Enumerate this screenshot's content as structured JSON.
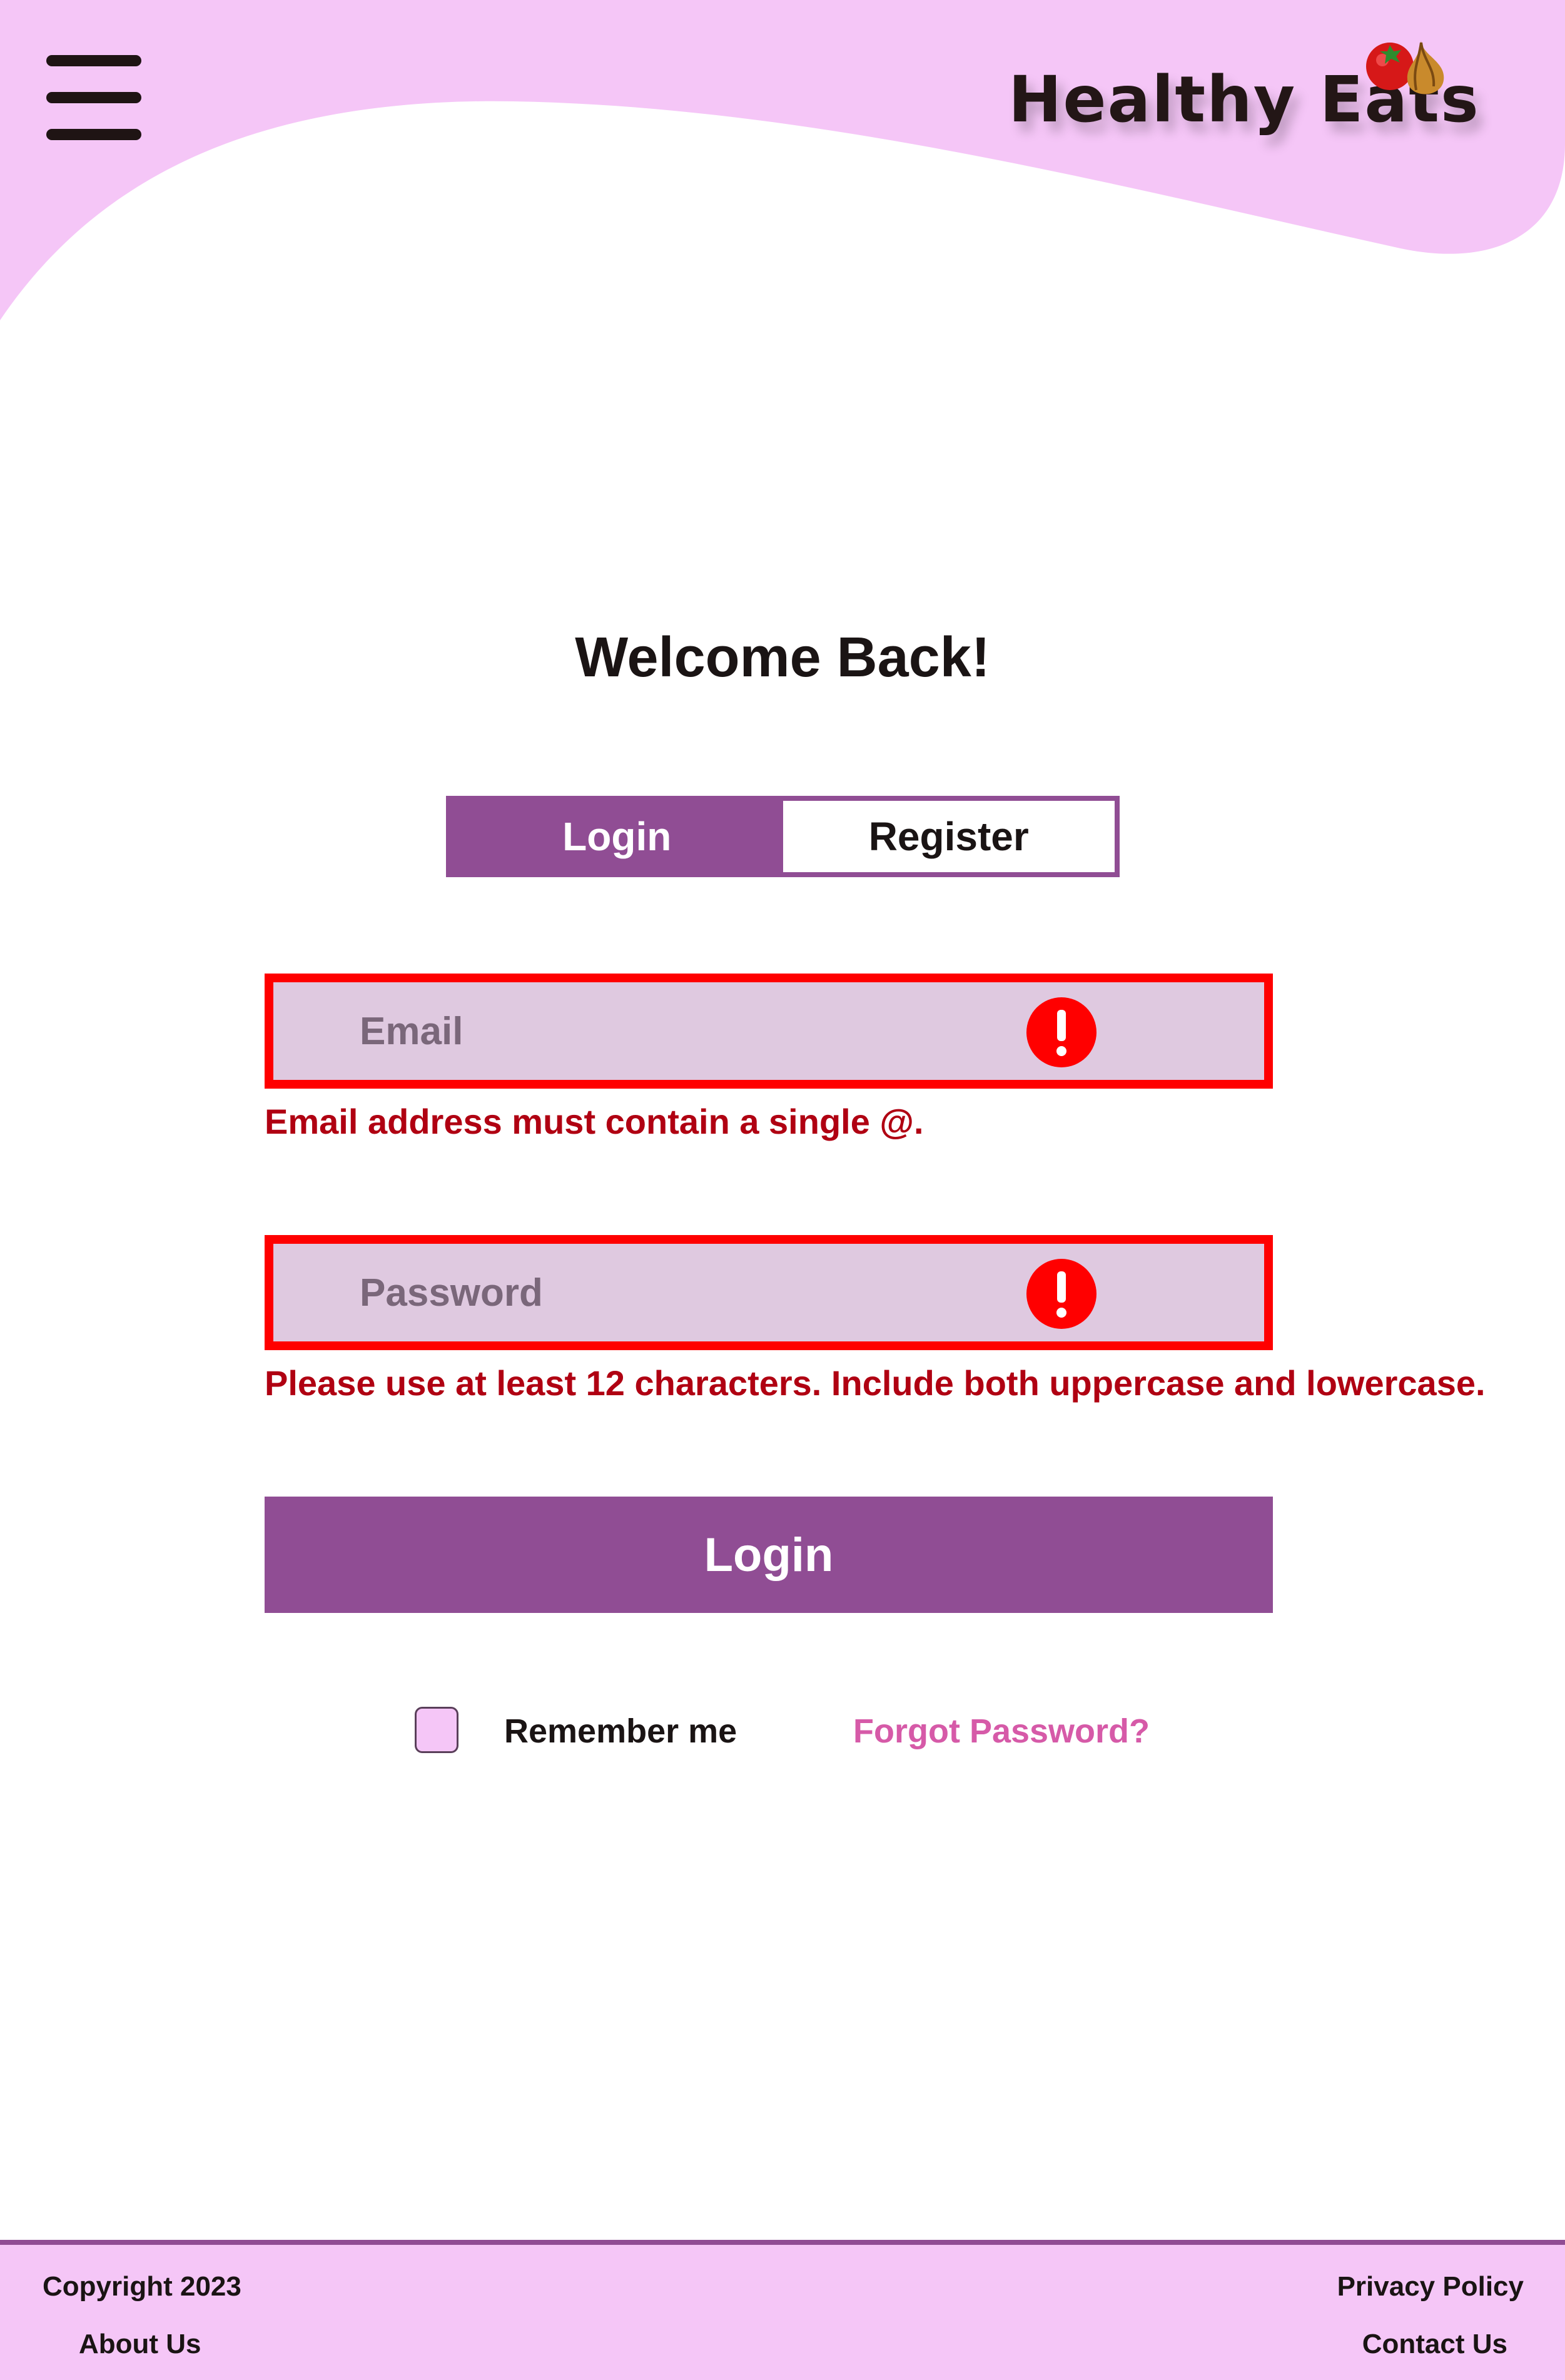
{
  "header": {
    "logo_text": "Healthy Eats",
    "menu_icon": "hamburger-menu-icon"
  },
  "colors": {
    "header_pink": "#f5c6f7",
    "primary_purple": "#904d94",
    "field_fill": "#dfc9e0",
    "error_red": "#ff0000",
    "error_text": "#b00012",
    "link_pink": "#d65aa8"
  },
  "main": {
    "title": "Welcome Back!",
    "tabs": [
      {
        "label": "Login",
        "active": true
      },
      {
        "label": "Register",
        "active": false
      }
    ],
    "email": {
      "placeholder": "Email",
      "value": "",
      "error": "Email address must contain a single @.",
      "icon": "error-alert-icon"
    },
    "password": {
      "placeholder": "Password",
      "value": "",
      "error": "Please use at least 12 characters. Include both uppercase and lowercase.",
      "icon": "error-alert-icon"
    },
    "login_button": "Login",
    "remember_me": {
      "label": "Remember me",
      "checked": false
    },
    "forgot_password": "Forgot Password?"
  },
  "footer": {
    "copyright": "Copyright 2023",
    "about": "About Us",
    "privacy": "Privacy Policy",
    "contact": "Contact Us"
  }
}
